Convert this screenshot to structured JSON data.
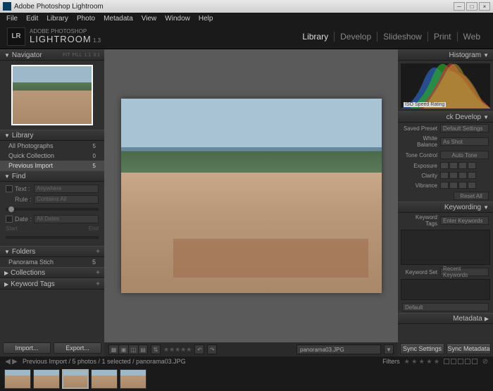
{
  "title": "Adobe Photoshop Lightroom",
  "menus": [
    "File",
    "Edit",
    "Library",
    "Photo",
    "Metadata",
    "View",
    "Window",
    "Help"
  ],
  "brand": {
    "top": "ADOBE PHOTOSHOP",
    "name": "LIGHTROOM",
    "ver": "1.3",
    "logo": "LR"
  },
  "modules": [
    "Library",
    "Develop",
    "Slideshow",
    "Print",
    "Web"
  ],
  "nav": {
    "title": "Navigator",
    "fit": "FIT",
    "fill": "FILL",
    "r1": "1:1",
    "r2": "3:1"
  },
  "library": {
    "title": "Library",
    "items": [
      {
        "label": "All Photographs",
        "count": "5"
      },
      {
        "label": "Quick Collection",
        "count": "0"
      },
      {
        "label": "Previous Import",
        "count": "5"
      }
    ]
  },
  "find": {
    "title": "Find",
    "text_lbl": "Text :",
    "text_val": "Anywhere",
    "rule_lbl": "Rule :",
    "rule_val": "Contains All",
    "date_lbl": "Date :",
    "date_val": "All Dates",
    "start": "Start",
    "end": "End"
  },
  "folders": {
    "title": "Folders",
    "items": [
      {
        "label": "Panorama Stich",
        "count": "5"
      }
    ]
  },
  "collections": {
    "title": "Collections"
  },
  "keywordtags": {
    "title": "Keyword Tags"
  },
  "import_btn": "Import...",
  "export_btn": "Export...",
  "histogram": {
    "title": "Histogram",
    "iso": "ISO Speed Rating"
  },
  "quickdev": {
    "title": "Quick Develop",
    "preset_lbl": "Saved Preset",
    "preset_val": "Default Settings",
    "wb_lbl": "White Balance",
    "wb_val": "As Shot",
    "tone_lbl": "Tone Control",
    "auto": "Auto Tone",
    "exp": "Exposure",
    "clarity": "Clarity",
    "vib": "Vibrance",
    "reset": "Reset All"
  },
  "keywording": {
    "title": "Keywording",
    "tags_lbl": "Keyword Tags",
    "enter": "Enter Keywords",
    "set_lbl": "Keyword Set",
    "set_val": "Recent Keywords"
  },
  "metadata": {
    "title": "Metadata",
    "default": "Default"
  },
  "sync": {
    "settings": "Sync Settings",
    "meta": "Sync Metadata"
  },
  "status": {
    "path": "Previous Import / 5 photos / 1 selected / panorama03.JPG",
    "filters": "Filters"
  },
  "toolbar": {
    "filename": "panorama03.JPG"
  }
}
